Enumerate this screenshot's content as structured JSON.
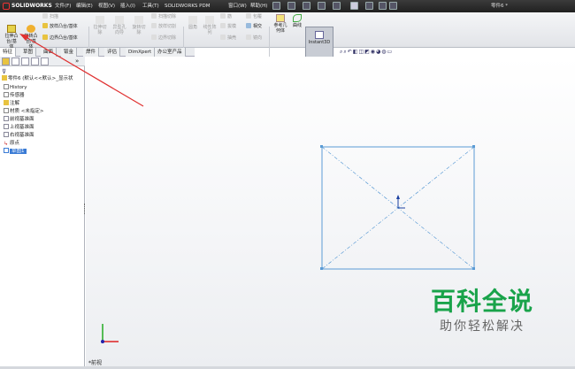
{
  "app": {
    "logo_text": "SOLIDWORKS",
    "document_title": "零件6 *"
  },
  "menu": [
    "文件(F)",
    "编辑(E)",
    "视图(V)",
    "插入(I)",
    "工具(T)",
    "SOLIDWORKS PDM",
    "窗口(W)",
    "帮助(H)"
  ],
  "ribbon": {
    "extrude_boss": "拉伸凸\n台/基\n体",
    "revolve_boss": "旋转凸\n台/基\n体",
    "sweep": "扫描",
    "loft": "放样凸台/基体",
    "boundary": "边界凸台/基体",
    "extrude_cut": "拉伸切\n除",
    "hole_wizard": "异型孔\n向导",
    "revolve_cut": "旋转切\n除",
    "swept_cut": "扫描切除",
    "lofted_cut": "放样切割",
    "boundary_cut": "边界切除",
    "fillet": "圆角",
    "linear_pattern": "线性阵\n列",
    "rib": "筋",
    "draft": "拔模",
    "shell": "抽壳",
    "wrap": "包覆",
    "intersect": "相交",
    "mirror": "镜向",
    "ref_geometry": "参考几\n何体",
    "curves": "曲线",
    "instant3d": "Instant3D"
  },
  "tabs": [
    "特征",
    "草图",
    "曲面",
    "钣金",
    "焊件",
    "评估",
    "DimXpert",
    "办公室产品"
  ],
  "active_tab": 0,
  "tree": {
    "root": "零件6 (默认<<默认>_显示状",
    "items": [
      "History",
      "传感器",
      "注解",
      "材质 <未指定>",
      "前视基准面",
      "上视基准面",
      "右视基准面",
      "原点",
      "草图1"
    ],
    "selected_index": 8
  },
  "view_label": "*前视",
  "watermark": {
    "line1": "百科全说",
    "line2": "助你轻松解决"
  },
  "colors": {
    "selection": "#3a7bd5",
    "sketch": "#5b9bd5",
    "arrow": "#e03030",
    "watermark": "#19a34a"
  }
}
